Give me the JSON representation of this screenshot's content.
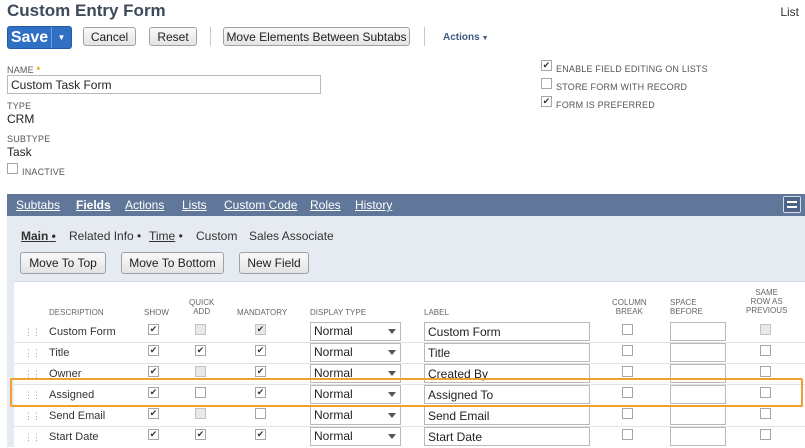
{
  "page": {
    "title": "Custom Entry Form",
    "list_link": "List"
  },
  "toolbar": {
    "save": "Save",
    "cancel": "Cancel",
    "reset": "Reset",
    "move_elements": "Move Elements Between Subtabs",
    "actions": "Actions"
  },
  "form": {
    "name_label": "NAME",
    "name_required": "*",
    "name_value": "Custom Task Form",
    "type_label": "TYPE",
    "type_value": "CRM",
    "subtype_label": "SUBTYPE",
    "subtype_value": "Task",
    "inactive_label": "INACTIVE",
    "enable_field_editing_label": "ENABLE FIELD EDITING ON LISTS",
    "store_form_label": "STORE FORM WITH RECORD",
    "form_preferred_label": "FORM IS PREFERRED"
  },
  "tabs": [
    "Subtabs",
    "Fields",
    "Actions",
    "Lists",
    "Custom Code",
    "Roles",
    "History"
  ],
  "subtabs": [
    "Main",
    "Related Info",
    "Time",
    "Custom",
    "Sales Associate"
  ],
  "grid_buttons": {
    "move_top": "Move To Top",
    "move_bottom": "Move To Bottom",
    "new_field": "New Field"
  },
  "columns": {
    "description": "DESCRIPTION",
    "show": "SHOW",
    "quick_add_1": "QUICK",
    "quick_add_2": "ADD",
    "mandatory": "MANDATORY",
    "display_type": "DISPLAY TYPE",
    "label": "LABEL",
    "column_break_1": "COLUMN",
    "column_break_2": "BREAK",
    "space_before_1": "SPACE",
    "space_before_2": "BEFORE",
    "same_row_1": "SAME",
    "same_row_2": "ROW AS",
    "same_row_3": "PREVIOUS"
  },
  "rows": [
    {
      "description": "Custom Form",
      "display_type": "Normal",
      "label": "Custom Form"
    },
    {
      "description": "Title",
      "display_type": "Normal",
      "label": "Title"
    },
    {
      "description": "Owner",
      "display_type": "Normal",
      "label": "Created By"
    },
    {
      "description": "Assigned",
      "display_type": "Normal",
      "label": "Assigned To"
    },
    {
      "description": "Send Email",
      "display_type": "Normal",
      "label": "Send Email"
    },
    {
      "description": "Start Date",
      "display_type": "Normal",
      "label": "Start Date"
    }
  ],
  "colors": {
    "save_button": "#2f6fc4",
    "tab_bar": "#607799",
    "panel": "#e6ebf2",
    "highlight": "#f0a030"
  }
}
